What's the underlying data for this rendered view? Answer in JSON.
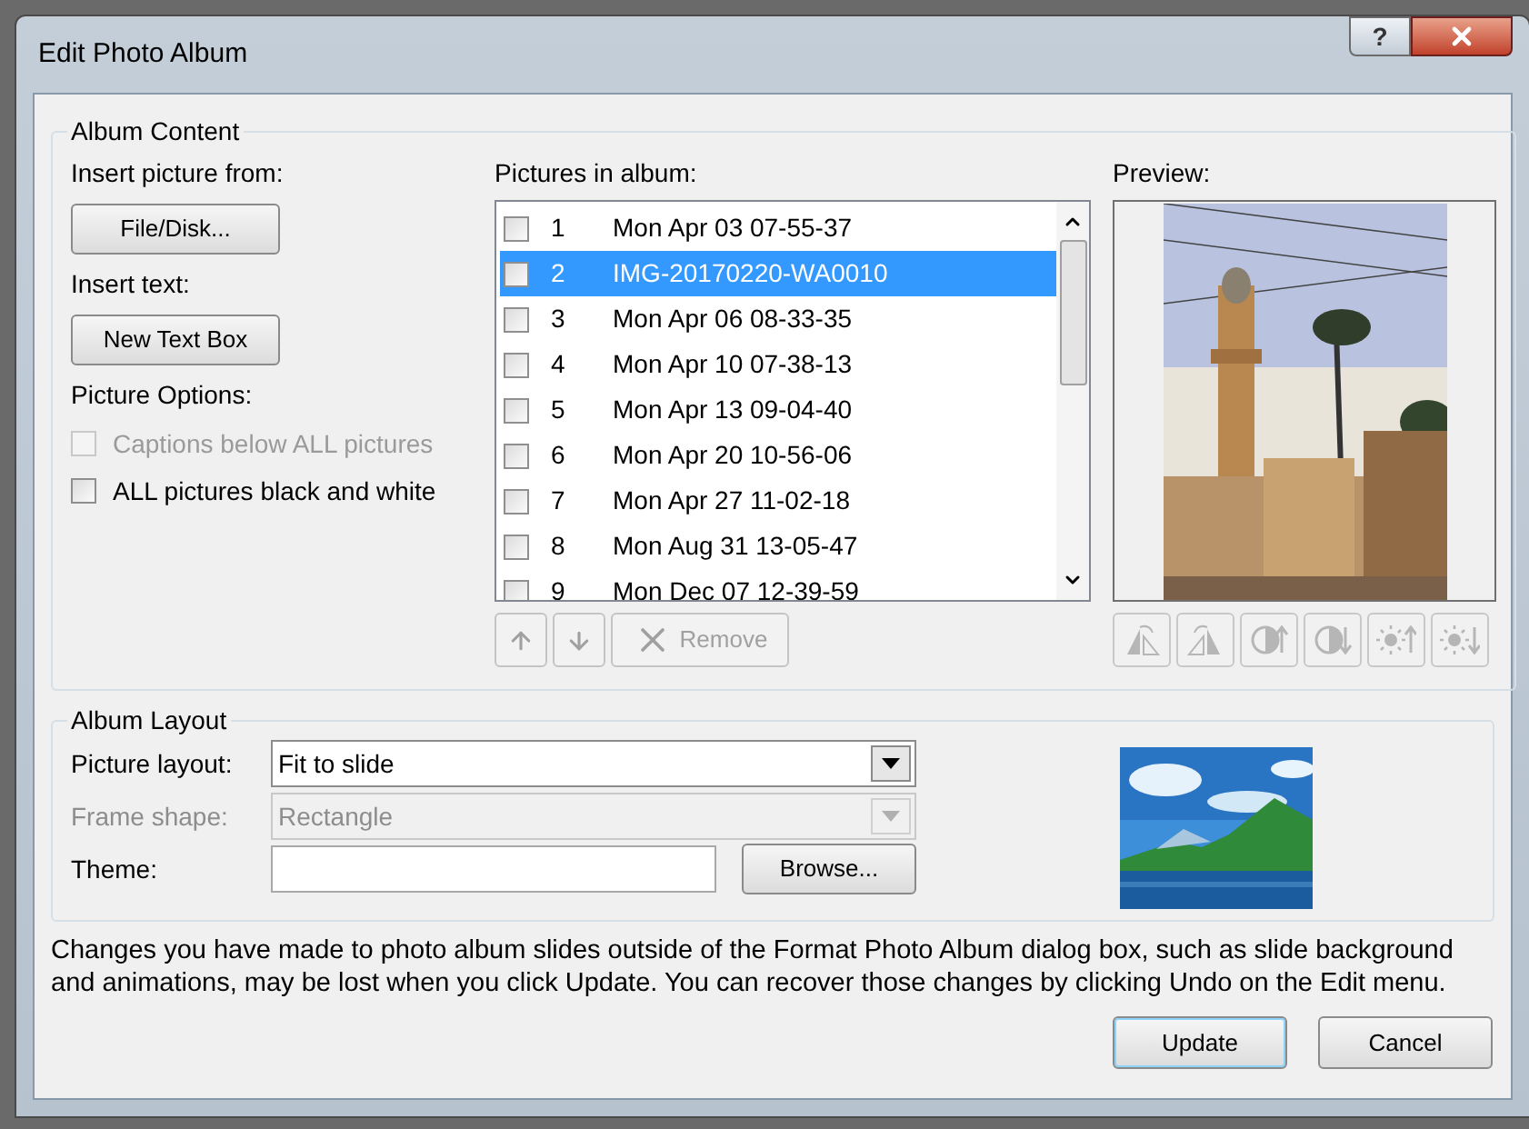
{
  "window": {
    "title": "Edit Photo Album",
    "help_button": "?"
  },
  "album_content": {
    "title": "Album Content",
    "insert_picture_label": "Insert picture from:",
    "file_button": {
      "label": "File/Disk..."
    },
    "insert_text_label": "Insert text:",
    "text_box_button": {
      "label": "New Text Box"
    },
    "picture_options_label": "Picture Options:",
    "options": [
      {
        "label": "Captions below ALL pictures",
        "checked": false,
        "disabled": true
      },
      {
        "label": "ALL pictures black and white",
        "checked": false,
        "disabled": false
      }
    ],
    "pictures_label": {
      "label": "Pictures in album:"
    },
    "pictures": [
      {
        "number": "1",
        "name": "Mon Apr 03 07-55-37",
        "checked": false,
        "selected": false
      },
      {
        "number": "2",
        "name": "IMG-20170220-WA0010",
        "checked": false,
        "selected": true
      },
      {
        "number": "3",
        "name": "Mon Apr 06 08-33-35",
        "checked": false,
        "selected": false
      },
      {
        "number": "4",
        "name": "Mon Apr 10 07-38-13",
        "checked": false,
        "selected": false
      },
      {
        "number": "5",
        "name": "Mon Apr 13 09-04-40",
        "checked": false,
        "selected": false
      },
      {
        "number": "6",
        "name": "Mon Apr 20 10-56-06",
        "checked": false,
        "selected": false
      },
      {
        "number": "7",
        "name": "Mon Apr 27 11-02-18",
        "checked": false,
        "selected": false
      },
      {
        "number": "8",
        "name": "Mon Aug 31 13-05-47",
        "checked": false,
        "selected": false
      },
      {
        "number": "9",
        "name": "Mon Dec 07 12-39-59",
        "checked": false,
        "selected": false
      }
    ],
    "list_buttons": [
      {
        "kind": "up",
        "disabled": true
      },
      {
        "kind": "down",
        "disabled": true
      },
      {
        "kind": "remove",
        "label": "Remove",
        "disabled": true
      }
    ],
    "preview_label": "Preview:",
    "preview_tools": [
      {
        "kind": "rotate-left",
        "disabled": true
      },
      {
        "kind": "rotate-right",
        "disabled": true
      },
      {
        "kind": "contrast-up",
        "disabled": true
      },
      {
        "kind": "contrast-down",
        "disabled": true
      },
      {
        "kind": "brightness-up",
        "disabled": true
      },
      {
        "kind": "brightness-down",
        "disabled": true
      }
    ]
  },
  "album_layout": {
    "title": "Album Layout",
    "fields": [
      {
        "kind": "dropdown",
        "label": "Picture layout:",
        "value": "Fit to slide",
        "disabled": false
      },
      {
        "kind": "dropdown",
        "label": "Frame shape:",
        "value": "Rectangle",
        "disabled": true
      },
      {
        "kind": "text",
        "label": "Theme:",
        "button": {
          "label": "Browse..."
        }
      }
    ]
  },
  "notice": "Changes you have made to photo album slides outside of the Format Photo Album dialog box, such as slide background and animations, may be lost when you click Update. You can recover those changes by clicking Undo on the Edit menu.",
  "buttons": [
    {
      "label": "Update",
      "default": true
    },
    {
      "label": "Cancel",
      "default": false
    }
  ]
}
